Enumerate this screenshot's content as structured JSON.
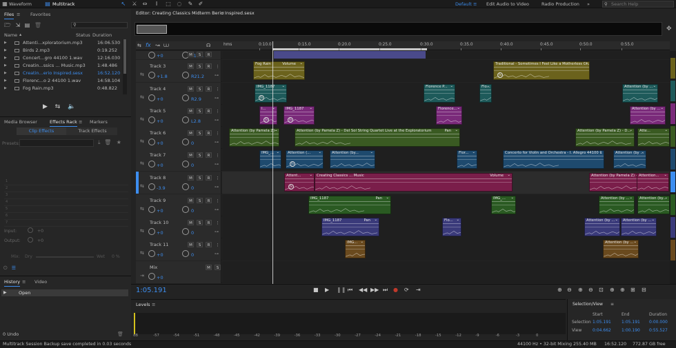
{
  "app": {
    "workspace_tabs": [
      "Waveform",
      "Multitrack"
    ],
    "workspaces": [
      "Default",
      "Edit Audio to Video",
      "Radio Production"
    ],
    "search_placeholder": "Search Help"
  },
  "files_panel": {
    "tabs": [
      "Files",
      "Favorites"
    ],
    "columns": {
      "name": "Name",
      "status": "Status",
      "duration": "Duration"
    },
    "files": [
      {
        "name": "Attenti...xploratorium.mp3",
        "duration": "16:06.530"
      },
      {
        "name": "Birds 2.mp3",
        "duration": "0:19.252"
      },
      {
        "name": "Concert...gro 44100 1.wav",
        "duration": "12:16.030"
      },
      {
        "name": "Creatin...ssics ... Music.mp3",
        "duration": "1:48.486"
      },
      {
        "name": "Creatin...erio Inspired.sesx",
        "duration": "16:52.120",
        "selected": true
      },
      {
        "name": "Florenc...o 2 44100 1.wav",
        "duration": "14:58.104"
      },
      {
        "name": "Fog Rain.mp3",
        "duration": "0:48.822"
      }
    ]
  },
  "effects_panel": {
    "tabs": [
      "Media Browser",
      "Effects Rack",
      "Markers"
    ],
    "subtabs": [
      "Clip Effects",
      "Track Effects"
    ],
    "presets_label": "Presets:",
    "slots": [
      "1",
      "2",
      "3",
      "4",
      "5",
      "6",
      "7",
      "8",
      "9",
      "10"
    ],
    "input_label": "Input:",
    "input_value": "+0",
    "output_label": "Output:",
    "output_value": "+0",
    "mix_label": "Mix:",
    "dry_label": "Dry",
    "wet_label": "Wet",
    "wet_value": "0 %"
  },
  "history_panel": {
    "tabs": [
      "History",
      "Video"
    ],
    "items": [
      "Open"
    ],
    "undo_count": "0 Undo"
  },
  "editor": {
    "title": "Editor: Creating Classics Midterm Berio Inspired.sesx",
    "ruler_label": "hms",
    "ruler_ticks": [
      "0:10.0",
      "0:15.0",
      "0:20.0",
      "0:25.0",
      "0:30.0",
      "0:35.0",
      "0:40.0",
      "0:45.0",
      "0:50.0",
      "0:55.0"
    ],
    "time_display": "1:05.191"
  },
  "tracks": [
    {
      "name": "",
      "vol": "+0",
      "pan": "L13.1",
      "color": "#4a4a8a"
    },
    {
      "name": "Track 3",
      "vol": "+1.8",
      "pan": "R21.2",
      "color": "#6b621c",
      "clips": [
        {
          "label": "Fog Rain",
          "right": "Volume",
          "color": "#6b621c",
          "fx": false
        },
        {
          "label": "Traditional - Sometimes I Feel Like a Motherless Ch...",
          "right": "",
          "color": "#6b621c",
          "fx": true
        }
      ]
    },
    {
      "name": "Track 4",
      "vol": "+0",
      "pan": "R2.9",
      "color": "#1e5a5a",
      "clips": [
        {
          "label": "IMG_1187",
          "color": "#1e5a5a",
          "fx": true
        },
        {
          "label": "Florence P...",
          "color": "#1e5a5a",
          "fx": false
        },
        {
          "label": "Flo...",
          "color": "#1e5a5a",
          "fx": false
        },
        {
          "label": "Attention (by ...",
          "color": "#1e5a5a",
          "fx": false
        }
      ]
    },
    {
      "name": "Track 5",
      "vol": "+0",
      "pan": "L2.8",
      "color": "#7a2a7a",
      "clips": [
        {
          "label": "I...",
          "color": "#7a2a7a",
          "fx": true
        },
        {
          "label": "IMG_1187",
          "color": "#7a2a7a",
          "fx": true
        },
        {
          "label": "Florence...",
          "color": "#7a2a7a",
          "fx": false
        },
        {
          "label": "Attention (by ...",
          "color": "#7a2a7a",
          "fx": false
        }
      ]
    },
    {
      "name": "Track 6",
      "vol": "+0",
      "pan": "0",
      "color": "#3a5a22",
      "clips": [
        {
          "label": "Attention (by Pamela Z) - D...",
          "color": "#3a5a22",
          "fx": false
        },
        {
          "label": "Attention (by Pamela Z) - Del Sol String Quartet Live at the Exploratorium",
          "right": "Pan",
          "color": "#3a5a22",
          "fx": false
        },
        {
          "label": "Attention (by Pamela Z) - D...",
          "color": "#3a5a22",
          "fx": false
        },
        {
          "label": "Atte...",
          "color": "#3a5a22",
          "fx": false
        }
      ]
    },
    {
      "name": "Track 7",
      "vol": "+0",
      "pan": "0",
      "color": "#1e4a6e",
      "clips": [
        {
          "label": "IMG_...",
          "color": "#1e4a6e",
          "fx": false
        },
        {
          "label": "Attention (...",
          "color": "#1e4a6e",
          "fx": true
        },
        {
          "label": "Attention (by...",
          "color": "#1e4a6e",
          "fx": false
        },
        {
          "label": "Flor...",
          "color": "#1e4a6e",
          "fx": false
        },
        {
          "label": "Concerto for Violin and Orchestra - I. Allegro 44100 1",
          "color": "#1e4a6e",
          "fx": false
        },
        {
          "label": "Attention (by ...",
          "color": "#1e4a6e",
          "fx": false
        }
      ]
    },
    {
      "name": "Track 8",
      "vol": "-3.9",
      "pan": "0",
      "color": "#7a1e4a",
      "clips": [
        {
          "label": "Attent...",
          "color": "#7a1e4a",
          "fx": true
        },
        {
          "label": "Creating Classics ... Music",
          "right": "Volume",
          "color": "#7a1e4a",
          "fx": false
        },
        {
          "label": "Attention (by Pamela Z) - ...",
          "color": "#7a1e4a",
          "fx": false
        },
        {
          "label": "Attention...",
          "color": "#7a1e4a",
          "fx": false
        }
      ]
    },
    {
      "name": "Track 9",
      "vol": "+0",
      "pan": "0",
      "color": "#2a5a22",
      "clips": [
        {
          "label": "IMG_1187",
          "right": "Pan",
          "color": "#2a5a22",
          "fx": false
        },
        {
          "label": "IMG_...",
          "color": "#2a5a22",
          "fx": false
        },
        {
          "label": "Attention (by ...",
          "color": "#2a5a22",
          "fx": false
        },
        {
          "label": "Attention (by...",
          "color": "#2a5a22",
          "fx": false
        }
      ]
    },
    {
      "name": "Track 10",
      "vol": "+0",
      "pan": "0",
      "color": "#3a3a7a",
      "clips": [
        {
          "label": "IMG_1187",
          "right": "Pan",
          "color": "#3a3a7a",
          "fx": false
        },
        {
          "label": "Flo...",
          "color": "#3a3a7a",
          "fx": false
        },
        {
          "label": "Attention (by ...",
          "color": "#3a3a7a",
          "fx": false
        },
        {
          "label": "Attention (by ...",
          "color": "#3a3a7a",
          "fx": false
        }
      ]
    },
    {
      "name": "Track 11",
      "vol": "+0",
      "pan": "0",
      "color": "#6a4a1e",
      "clips": [
        {
          "label": "IMG...",
          "color": "#6a4a1e",
          "fx": false
        },
        {
          "label": "Attention (by ...",
          "color": "#6a4a1e",
          "fx": false
        }
      ]
    },
    {
      "name": "Mix",
      "vol": "+0",
      "pan": "",
      "color": "#3a3a3a"
    }
  ],
  "levels_panel": {
    "title": "Levels",
    "scale": [
      "dB",
      "-57",
      "-54",
      "-51",
      "-48",
      "-45",
      "-42",
      "-39",
      "-36",
      "-33",
      "-30",
      "-27",
      "-24",
      "-21",
      "-18",
      "-15",
      "-12",
      "-9",
      "-6",
      "-3",
      "0"
    ]
  },
  "selection_view": {
    "title": "Selection/View",
    "headers": [
      "Start",
      "End",
      "Duration"
    ],
    "selection_label": "Selection",
    "view_label": "View",
    "selection": [
      "1:05.191",
      "1:05.191",
      "0:00.000"
    ],
    "view": [
      "0:04.662",
      "1:00.190",
      "0:55.527"
    ]
  },
  "status_bar": {
    "message": "Multitrack Session Backup save completed in 0.03 seconds",
    "sample_rate": "44100 Hz • 32-bit Mixing",
    "memory": "255.40 MB",
    "duration": "16:52.120",
    "free_space": "772.87 GB free"
  },
  "colors": {
    "accent": "#3d8ef0",
    "background": "#232323"
  }
}
